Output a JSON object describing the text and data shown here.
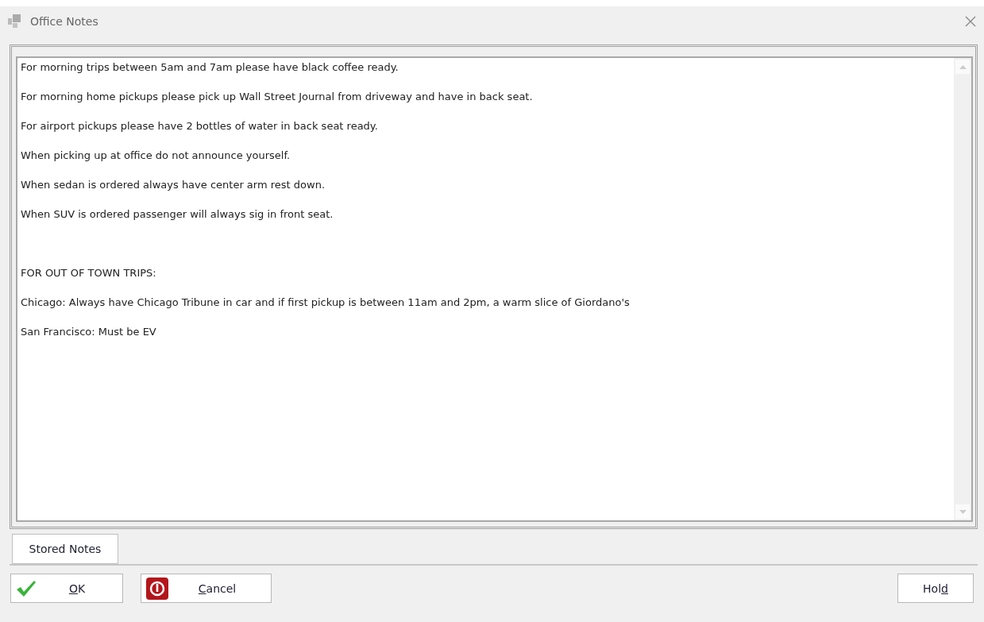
{
  "window": {
    "title": "Office Notes"
  },
  "note_blocks": [
    [
      "For morning trips between 5am and 7am please have black coffee ready.",
      "For morning home pickups please pick up Wall Street Journal from driveway and have in back seat.",
      "For airport pickups please have 2 bottles of water in back seat ready.",
      "When picking up at office do not announce yourself.",
      "When sedan is ordered always have center arm rest down.",
      "When SUV is ordered passenger will always sig in front seat."
    ],
    [
      "FOR OUT OF TOWN TRIPS:",
      "Chicago: Always have Chicago Tribune in car and if first pickup is between 11am and 2pm, a warm slice of Giordano's",
      "San Francisco: Must be EV"
    ]
  ],
  "tab_button": {
    "label": "Stored Notes"
  },
  "buttons": [
    {
      "kind": "ok",
      "key": "O",
      "after": "K"
    },
    {
      "kind": "cancel",
      "key": "C",
      "after": "ancel"
    },
    {
      "kind": "hold",
      "before": "Hol",
      "key": "d"
    }
  ]
}
